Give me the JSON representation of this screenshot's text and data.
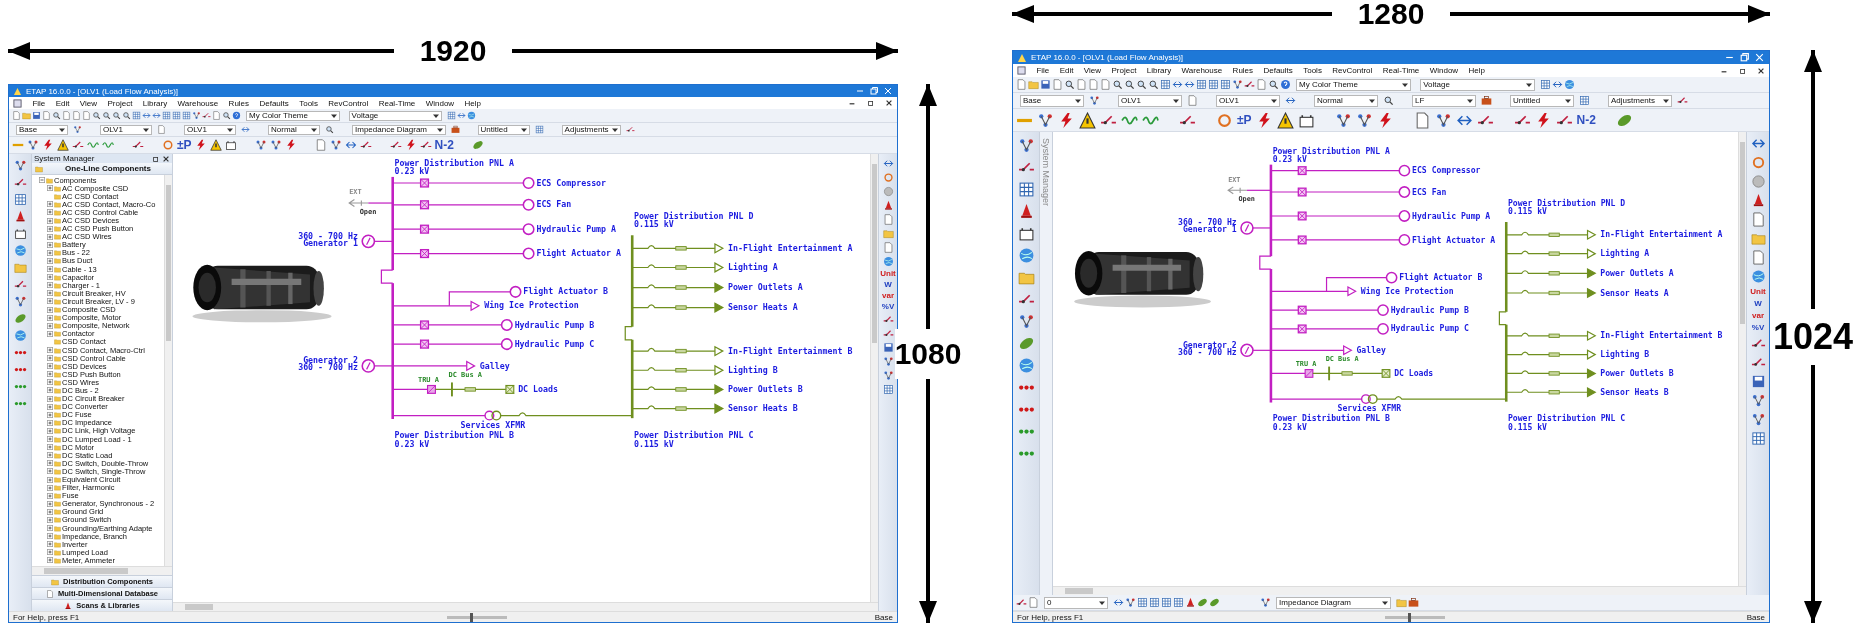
{
  "screens": [
    {
      "width_label": "1920",
      "height_label": "1080",
      "window": {
        "title": "ETAP 16.0.0 - [OLV1 (Load Flow Analysis)]",
        "menu": [
          "File",
          "Edit",
          "View",
          "Project",
          "Library",
          "Warehouse",
          "Rules",
          "Defaults",
          "Tools",
          "RevControl",
          "Real-Time",
          "Window",
          "Help"
        ],
        "toolbar_rows": [
          [
            "My Color Theme",
            "Voltage"
          ],
          [
            "Base",
            "OLV1",
            "OLV1",
            "Normal",
            "Impedance Diagram",
            "Untitled",
            "Adjustments"
          ]
        ],
        "tool_texts": [
          "±P",
          "N-2"
        ],
        "system_manager": {
          "title": "System Manager",
          "header": "One-Line Components",
          "tree": {
            "label": "Components",
            "kind": "group",
            "expanded": true,
            "children": [
              {
                "label": "AC Composite CSD",
                "kind": "group",
                "expanded": false
              },
              {
                "label": "AC CSD Contact",
                "kind": "leaf"
              },
              {
                "label": "AC CSD Contact, Macro-Co",
                "kind": "group",
                "expanded": false
              },
              {
                "label": "AC CSD Control Cable",
                "kind": "group",
                "expanded": false
              },
              {
                "label": "AC CSD Devices",
                "kind": "group",
                "expanded": false
              },
              {
                "label": "AC CSD Push Button",
                "kind": "group",
                "expanded": false
              },
              {
                "label": "AC CSD Wires",
                "kind": "group",
                "expanded": false
              },
              {
                "label": "Battery",
                "kind": "group",
                "expanded": false
              },
              {
                "label": "Bus - 22",
                "kind": "group",
                "expanded": false
              },
              {
                "label": "Bus Duct",
                "kind": "group",
                "expanded": false
              },
              {
                "label": "Cable - 13",
                "kind": "group",
                "expanded": false
              },
              {
                "label": "Capacitor",
                "kind": "group",
                "expanded": false
              },
              {
                "label": "Charger - 1",
                "kind": "group",
                "expanded": false
              },
              {
                "label": "Circuit Breaker, HV",
                "kind": "group",
                "expanded": false
              },
              {
                "label": "Circuit Breaker, LV - 9",
                "kind": "group",
                "expanded": false
              },
              {
                "label": "Composite CSD",
                "kind": "group",
                "expanded": false
              },
              {
                "label": "Composite, Motor",
                "kind": "group",
                "expanded": false
              },
              {
                "label": "Composite, Network",
                "kind": "group",
                "expanded": false
              },
              {
                "label": "Contactor",
                "kind": "group",
                "expanded": false
              },
              {
                "label": "CSD Contact",
                "kind": "leaf"
              },
              {
                "label": "CSD Contact, Macro-Ctrl",
                "kind": "group",
                "expanded": false
              },
              {
                "label": "CSD Control Cable",
                "kind": "group",
                "expanded": false
              },
              {
                "label": "CSD Devices",
                "kind": "group",
                "expanded": false
              },
              {
                "label": "CSD Push Button",
                "kind": "group",
                "expanded": false
              },
              {
                "label": "CSD Wires",
                "kind": "group",
                "expanded": false
              },
              {
                "label": "DC Bus - 2",
                "kind": "group",
                "expanded": false
              },
              {
                "label": "DC Circuit Breaker",
                "kind": "group",
                "expanded": false
              },
              {
                "label": "DC Converter",
                "kind": "group",
                "expanded": false
              },
              {
                "label": "DC Fuse",
                "kind": "group",
                "expanded": false
              },
              {
                "label": "DC Impedance",
                "kind": "group",
                "expanded": false
              },
              {
                "label": "DC Link, High Voltage",
                "kind": "group",
                "expanded": false
              },
              {
                "label": "DC Lumped Load - 1",
                "kind": "group",
                "expanded": false
              },
              {
                "label": "DC Motor",
                "kind": "group",
                "expanded": false
              },
              {
                "label": "DC Static Load",
                "kind": "group",
                "expanded": false
              },
              {
                "label": "DC Switch, Double-Throw",
                "kind": "group",
                "expanded": false
              },
              {
                "label": "DC Switch, Single-Throw",
                "kind": "group",
                "expanded": false
              },
              {
                "label": "Equivalent Circuit",
                "kind": "group",
                "expanded": false
              },
              {
                "label": "Filter, Harmonic",
                "kind": "group",
                "expanded": false
              },
              {
                "label": "Fuse",
                "kind": "group",
                "expanded": false
              },
              {
                "label": "Generator, Synchronous - 2",
                "kind": "group",
                "expanded": false
              },
              {
                "label": "Ground Grid",
                "kind": "group",
                "expanded": false
              },
              {
                "label": "Ground Switch",
                "kind": "group",
                "expanded": false
              },
              {
                "label": "Grounding/Earthing Adapte",
                "kind": "group",
                "expanded": false
              },
              {
                "label": "Impedance, Branch",
                "kind": "group",
                "expanded": false
              },
              {
                "label": "Inverter",
                "kind": "group",
                "expanded": false
              },
              {
                "label": "Lumped Load",
                "kind": "group",
                "expanded": false
              },
              {
                "label": "Meter, Ammeter",
                "kind": "group",
                "expanded": false
              }
            ]
          },
          "bottom_tabs": [
            "Distribution Components",
            "Multi-Dimensional Database",
            "Scans & Libraries"
          ]
        },
        "strip_texts": [
          "Unit",
          "W",
          "var",
          "%V"
        ],
        "diagram": {
          "bus_a": {
            "name": "Power Distribution PNL A",
            "voltage": "0.23 kV"
          },
          "bus_b": {
            "name": "Power Distribution PNL B",
            "voltage": "0.23 kV"
          },
          "bus_d": {
            "name": "Power Distribution PNL D",
            "voltage": "0.115 kV"
          },
          "bus_c": {
            "name": "Power Distribution PNL C",
            "voltage": "0.115 kV"
          },
          "ext": {
            "name": "EXT",
            "status": "Open"
          },
          "generators": [
            {
              "name": "Generator 1",
              "rating": "360 - 700 Hz"
            },
            {
              "name": "Generator 2",
              "rating": "360 - 700 Hz"
            }
          ],
          "loads_a": [
            {
              "name": "ECS Compressor",
              "kind": "motor"
            },
            {
              "name": "ECS Fan",
              "kind": "motor"
            },
            {
              "name": "Hydraulic Pump A",
              "kind": "motor"
            },
            {
              "name": "Flight Actuator A",
              "kind": "motor"
            }
          ],
          "loads_b": [
            {
              "name": "Flight Actuator B",
              "kind": "motor"
            },
            {
              "name": "Wing Ice Protection",
              "kind": "static"
            },
            {
              "name": "Hydraulic Pump B",
              "kind": "motor"
            },
            {
              "name": "Hydraulic Pump C",
              "kind": "motor"
            },
            {
              "name": "Galley",
              "kind": "static"
            }
          ],
          "dc": {
            "converter": "TRU A",
            "bus": "DC Bus A",
            "load": "DC Loads"
          },
          "transformer": "Services XFMR",
          "loads_d": [
            {
              "name": "In-Flight Entertainment A",
              "kind": "static"
            },
            {
              "name": "Lighting A",
              "kind": "static"
            },
            {
              "name": "Power Outlets A",
              "kind": "lumped"
            },
            {
              "name": "Sensor Heats A",
              "kind": "lumped"
            }
          ],
          "loads_c": [
            {
              "name": "In-Flight Entertainment B",
              "kind": "static"
            },
            {
              "name": "Lighting B",
              "kind": "static"
            },
            {
              "name": "Power Outlets B",
              "kind": "lumped"
            },
            {
              "name": "Sensor Heats B",
              "kind": "lumped"
            }
          ]
        },
        "status_bar": {
          "help": "For Help, press F1",
          "zoom": {
            "level": 0.4
          },
          "mode": "Base"
        }
      }
    },
    {
      "width_label": "1280",
      "height_label": "1024",
      "window": {
        "title": "ETAP 16.0.0 - [OLV1 (Load Flow Analysis)]",
        "menu": [
          "File",
          "Edit",
          "View",
          "Project",
          "Library",
          "Warehouse",
          "Rules",
          "Defaults",
          "Tools",
          "RevControl",
          "Real-Time",
          "Window",
          "Help"
        ],
        "toolbar_rows": [
          [
            "My Color Theme",
            "Voltage"
          ],
          [
            "Base",
            "OLV1",
            "OLV1",
            "Normal",
            "LF",
            "Untitled",
            "Adjustments"
          ]
        ],
        "tool_texts": [
          "±P",
          "N-2"
        ],
        "system_manager_tab": "System Manager",
        "strip_texts": [
          "Unit",
          "W",
          "var",
          "%V"
        ],
        "diagram": {
          "bus_a": {
            "name": "Power Distribution PNL A",
            "voltage": "0.23 kV"
          },
          "bus_b": {
            "name": "Power Distribution PNL B",
            "voltage": "0.23 kV"
          },
          "bus_d": {
            "name": "Power Distribution PNL D",
            "voltage": "0.115 kV"
          },
          "bus_c": {
            "name": "Power Distribution PNL C",
            "voltage": "0.115 kV"
          },
          "ext": {
            "name": "EXT",
            "status": "Open"
          },
          "generators": [
            {
              "name": "Generator 1",
              "rating": "360 - 700 Hz"
            },
            {
              "name": "Generator 2",
              "rating": "360 - 700 Hz"
            }
          ],
          "loads_a": [
            {
              "name": "ECS Compressor",
              "kind": "motor"
            },
            {
              "name": "ECS Fan",
              "kind": "motor"
            },
            {
              "name": "Hydraulic Pump A",
              "kind": "motor"
            },
            {
              "name": "Flight Actuator A",
              "kind": "motor"
            }
          ],
          "loads_b": [
            {
              "name": "Flight Actuator B",
              "kind": "motor"
            },
            {
              "name": "Wing Ice Protection",
              "kind": "static"
            },
            {
              "name": "Hydraulic Pump B",
              "kind": "motor"
            },
            {
              "name": "Hydraulic Pump C",
              "kind": "motor"
            },
            {
              "name": "Galley",
              "kind": "static"
            }
          ],
          "dc": {
            "converter": "TRU A",
            "bus": "DC Bus A",
            "load": "DC Loads"
          },
          "transformer": "Services XFMR",
          "loads_d": [
            {
              "name": "In-Flight Entertainment A",
              "kind": "static"
            },
            {
              "name": "Lighting A",
              "kind": "static"
            },
            {
              "name": "Power Outlets A",
              "kind": "lumped"
            },
            {
              "name": "Sensor Heats A",
              "kind": "lumped"
            }
          ],
          "loads_c": [
            {
              "name": "In-Flight Entertainment B",
              "kind": "static"
            },
            {
              "name": "Lighting B",
              "kind": "static"
            },
            {
              "name": "Power Outlets B",
              "kind": "lumped"
            },
            {
              "name": "Sensor Heats B",
              "kind": "lumped"
            }
          ]
        },
        "bottom_toolbar": [
          "0",
          "Impedance Diagram"
        ],
        "status_bar": {
          "help": "For Help, press F1",
          "zoom": {
            "level": 0.4
          },
          "mode": "Base"
        }
      }
    }
  ]
}
